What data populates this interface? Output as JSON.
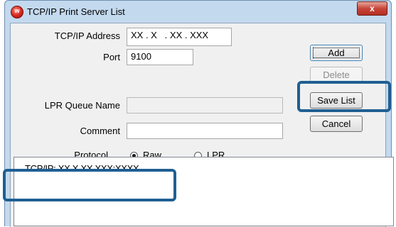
{
  "window": {
    "title": "TCP/IP Print Server List",
    "close_glyph": "x",
    "icon_letter": "w"
  },
  "form": {
    "ip_label": "TCP/IP Address",
    "ip_value": "XX . X   . XX . XXX",
    "port_label": "Port",
    "port_value": "9100",
    "lpr_label": "LPR Queue Name",
    "lpr_value": "",
    "comment_label": "Comment",
    "comment_value": "",
    "protocol_label": "Protocol",
    "protocol_options": [
      "Raw",
      "LPR"
    ],
    "protocol_selected": "Raw"
  },
  "buttons": {
    "add": "Add",
    "delete": "Delete",
    "save_list": "Save List",
    "cancel": "Cancel"
  },
  "server_list": {
    "items": [
      "TCP/IP: XX.X.XX.XXX:XXXX"
    ]
  },
  "colors": {
    "highlight": "#1f5f93",
    "title_bar": "#c3d9ee",
    "close_button": "#c8453a"
  }
}
